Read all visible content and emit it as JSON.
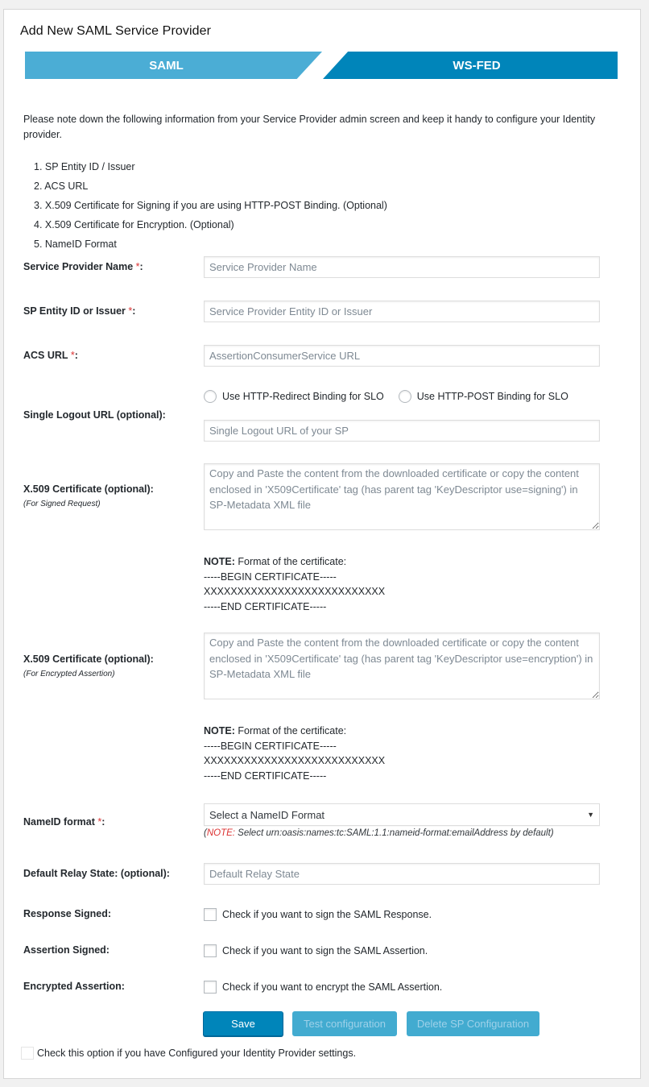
{
  "title": "Add New SAML Service Provider",
  "tabs": [
    {
      "label": "SAML",
      "color": "#4badd5",
      "active": true
    },
    {
      "label": "WS-FED",
      "color": "#0085ba",
      "active": false
    }
  ],
  "intro": "Please note down the following information from your Service Provider admin screen and keep it handy to configure your Identity provider.",
  "steps": [
    "1. SP Entity ID / Issuer",
    "2. ACS URL",
    "3. X.509 Certificate for Signing if you are using HTTP-POST Binding. (Optional)",
    "4. X.509 Certificate for Encryption. (Optional)",
    "5. NameID Format"
  ],
  "fields": {
    "sp_name": {
      "label": "Service Provider Name ",
      "required": "*",
      "suffix": ":",
      "placeholder": "Service Provider Name",
      "value": ""
    },
    "sp_entity": {
      "label": "SP Entity ID or Issuer ",
      "required": "*",
      "suffix": ":",
      "placeholder": "Service Provider Entity ID or Issuer",
      "value": ""
    },
    "acs_url": {
      "label": "ACS URL ",
      "required": "*",
      "suffix": ":",
      "placeholder": "AssertionConsumerService URL",
      "value": ""
    },
    "slo": {
      "label": "Single Logout URL (optional):",
      "radio_redirect": "Use HTTP-Redirect Binding for SLO",
      "radio_post": "Use HTTP-POST Binding for SLO",
      "placeholder": "Single Logout URL of your SP",
      "value": ""
    },
    "cert_signing": {
      "label": "X.509 Certificate (optional):",
      "sublabel": "(For Signed Request)",
      "placeholder": "Copy and Paste the content from the downloaded certificate or copy the content enclosed in 'X509Certificate' tag (has parent tag 'KeyDescriptor use=signing') in SP-Metadata XML file"
    },
    "cert_encryption": {
      "label": "X.509 Certificate (optional):",
      "sublabel": "(For Encrypted Assertion)",
      "placeholder": "Copy and Paste the content from the downloaded certificate or copy the content enclosed in 'X509Certificate' tag (has parent tag 'KeyDescriptor use=encryption') in SP-Metadata XML file"
    },
    "cert_note": {
      "note_bold": "NOTE:",
      "note_text": " Format of the certificate:",
      "begin": "-----BEGIN CERTIFICATE-----",
      "body": "XXXXXXXXXXXXXXXXXXXXXXXXXXX",
      "end": "-----END CERTIFICATE-----"
    },
    "nameid": {
      "label": "NameID format ",
      "required": "*",
      "suffix": ":",
      "selected": "Select a NameID Format",
      "note_open": "(",
      "note_red": "NOTE:",
      "note_text": " Select urn:oasis:names:tc:SAML:1.1:nameid-format:emailAddress by default)"
    },
    "relay_state": {
      "label": "Default Relay State: (optional):",
      "placeholder": "Default Relay State",
      "value": ""
    },
    "response_signed": {
      "label": "Response Signed:",
      "checkbox_label": "Check if you want to sign the SAML Response.",
      "checked": false
    },
    "assertion_signed": {
      "label": "Assertion Signed:",
      "checkbox_label": "Check if you want to sign the SAML Assertion.",
      "checked": false
    },
    "encrypted_assertion": {
      "label": "Encrypted Assertion:",
      "checkbox_label": "Check if you want to encrypt the SAML Assertion.",
      "checked": false
    }
  },
  "buttons": {
    "save": "Save",
    "test": "Test configuration",
    "delete": "Delete SP Configuration"
  },
  "final_check": {
    "label": "Check this option if you have Configured your Identity Provider settings.",
    "checked": false
  },
  "colors": {
    "primary": "#0085ba",
    "tab_light": "#4badd5",
    "required": "#dc3232"
  }
}
